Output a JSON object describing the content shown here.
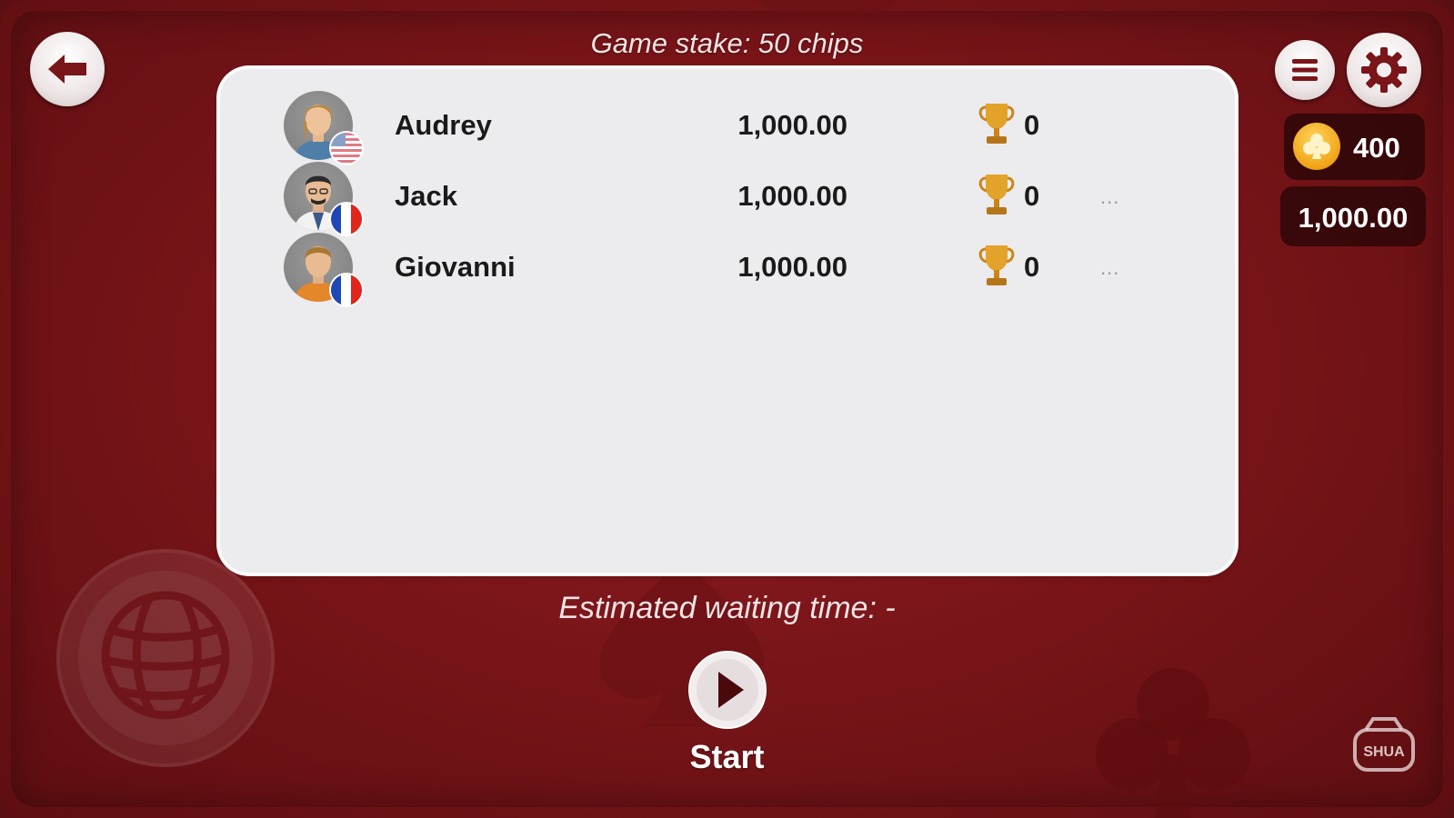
{
  "header": {
    "stake_text": "Game stake: 50 chips"
  },
  "players": [
    {
      "name": "Audrey",
      "balance": "1,000.00",
      "trophies": "0",
      "flag": "us-flag",
      "more": ""
    },
    {
      "name": "Jack",
      "balance": "1,000.00",
      "trophies": "0",
      "flag": "france-flag",
      "more": "..."
    },
    {
      "name": "Giovanni",
      "balance": "1,000.00",
      "trophies": "0",
      "flag": "france-flag",
      "more": "..."
    }
  ],
  "wallet": {
    "chips": "400",
    "balance": "1,000.00"
  },
  "footer": {
    "wait_text": "Estimated waiting time: -",
    "start_label": "Start"
  },
  "shop": {
    "badge_text": "SHUA"
  },
  "icons": {
    "back": "back-arrow-icon",
    "menu": "menu-icon",
    "settings": "gear-icon",
    "globe": "globe-icon",
    "start": "play-icon",
    "shop": "shop-icon",
    "trophy": "trophy-icon",
    "chip": "club-coin-icon"
  },
  "colors": {
    "background": "#7a1519",
    "panel": "#ecebee",
    "accent_gold": "#f0a418",
    "text_dark": "#1a1a1a"
  }
}
